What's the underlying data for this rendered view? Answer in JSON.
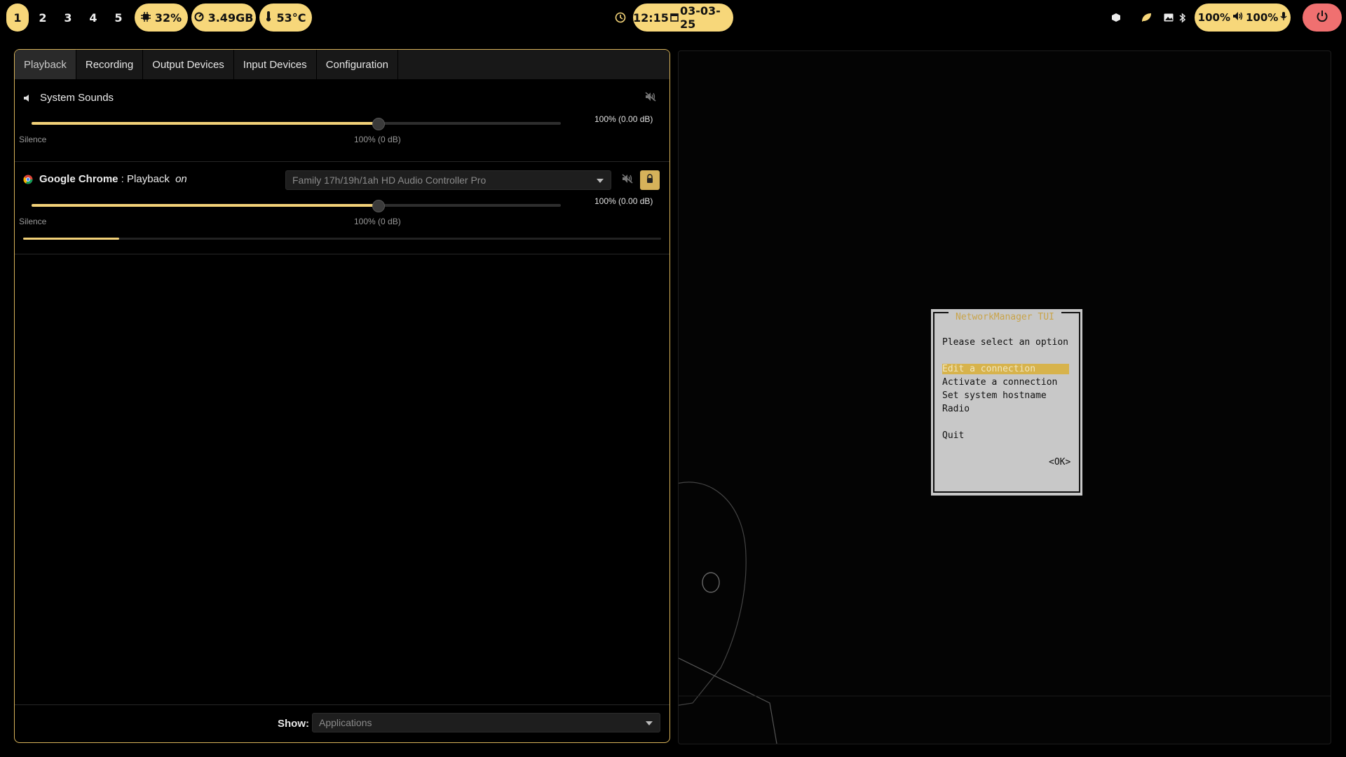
{
  "topbar": {
    "workspaces": [
      "1",
      "2",
      "3",
      "4",
      "5"
    ],
    "active_workspace": "1",
    "cpu": "32%",
    "memory": "3.49GB",
    "temperature": "53°C",
    "time": "12:15",
    "date": "03-03-25",
    "volume": "100%",
    "mic": "100%",
    "colors": {
      "accent": "#f7d77a",
      "power": "#f07070"
    }
  },
  "pavucontrol": {
    "tabs": [
      "Playback",
      "Recording",
      "Output Devices",
      "Input Devices",
      "Configuration"
    ],
    "active_tab": "Playback",
    "system_sounds": {
      "label": "System Sounds",
      "volume_pct": 100,
      "volume_text": "100% (0.00 dB)",
      "min_label": "Silence",
      "mark_label": "100% (0 dB)"
    },
    "chrome": {
      "app_name": "Google Chrome",
      "separator": " : ",
      "stream": "Playback",
      "on_label": "on",
      "device": "Family 17h/19h/1ah HD Audio Controller Pro",
      "volume_pct": 100,
      "volume_text": "100% (0.00 dB)",
      "min_label": "Silence",
      "mark_label": "100% (0 dB)",
      "level_fraction": 0.15
    },
    "show_label": "Show:",
    "show_value": "Applications"
  },
  "nmtui": {
    "title": "NetworkManager TUI",
    "prompt": "Please select an option",
    "options": [
      "Edit a connection",
      "Activate a connection",
      "Set system hostname",
      "Radio"
    ],
    "selected": "Edit a connection",
    "quit": "Quit",
    "ok": "<OK>"
  }
}
